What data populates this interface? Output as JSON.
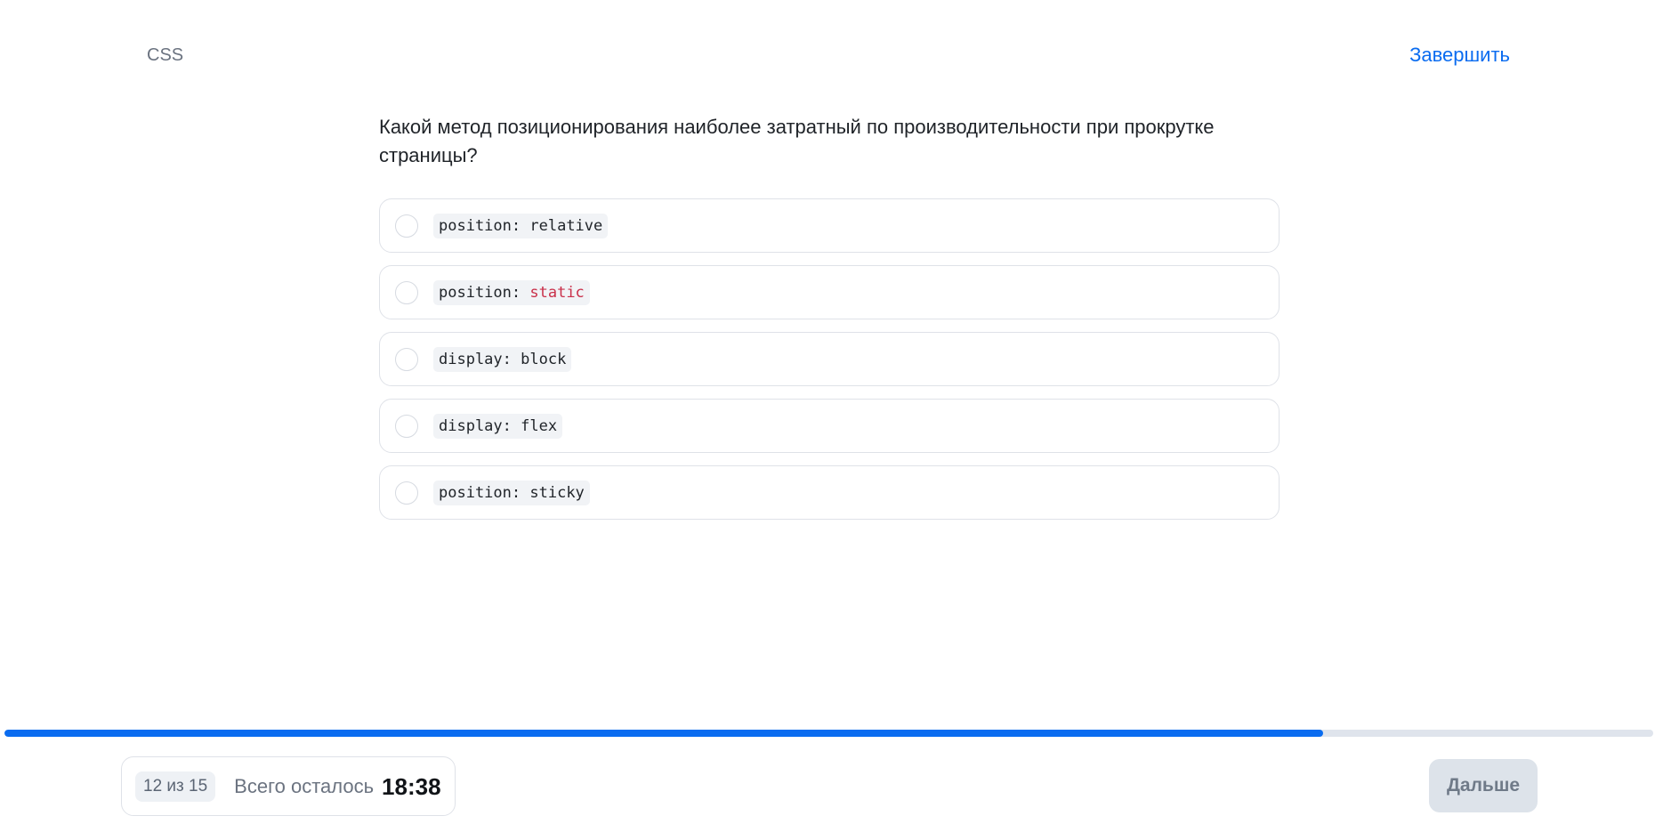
{
  "header": {
    "topic": "CSS",
    "finish_label": "Завершить"
  },
  "question": {
    "text": "Какой метод позиционирования наиболее затратный по производительности при прокрутке страницы?"
  },
  "options": [
    {
      "property": "position:",
      "value": "relative",
      "value_highlighted": false,
      "selected": false
    },
    {
      "property": "position:",
      "value": "static",
      "value_highlighted": true,
      "selected": false
    },
    {
      "property": "display:",
      "value": "block",
      "value_highlighted": false,
      "selected": false
    },
    {
      "property": "display:",
      "value": "flex",
      "value_highlighted": false,
      "selected": false
    },
    {
      "property": "position:",
      "value": "sticky",
      "value_highlighted": false,
      "selected": false
    }
  ],
  "progress": {
    "fraction": 0.8
  },
  "footer": {
    "counter": "12 из 15",
    "remaining_label": "Всего осталось",
    "timer": "18:38",
    "next_label": "Дальше",
    "next_enabled": false
  },
  "colors": {
    "accent": "#0a6cf0",
    "keyword": "#c9304a",
    "track": "#dfe4ec"
  }
}
